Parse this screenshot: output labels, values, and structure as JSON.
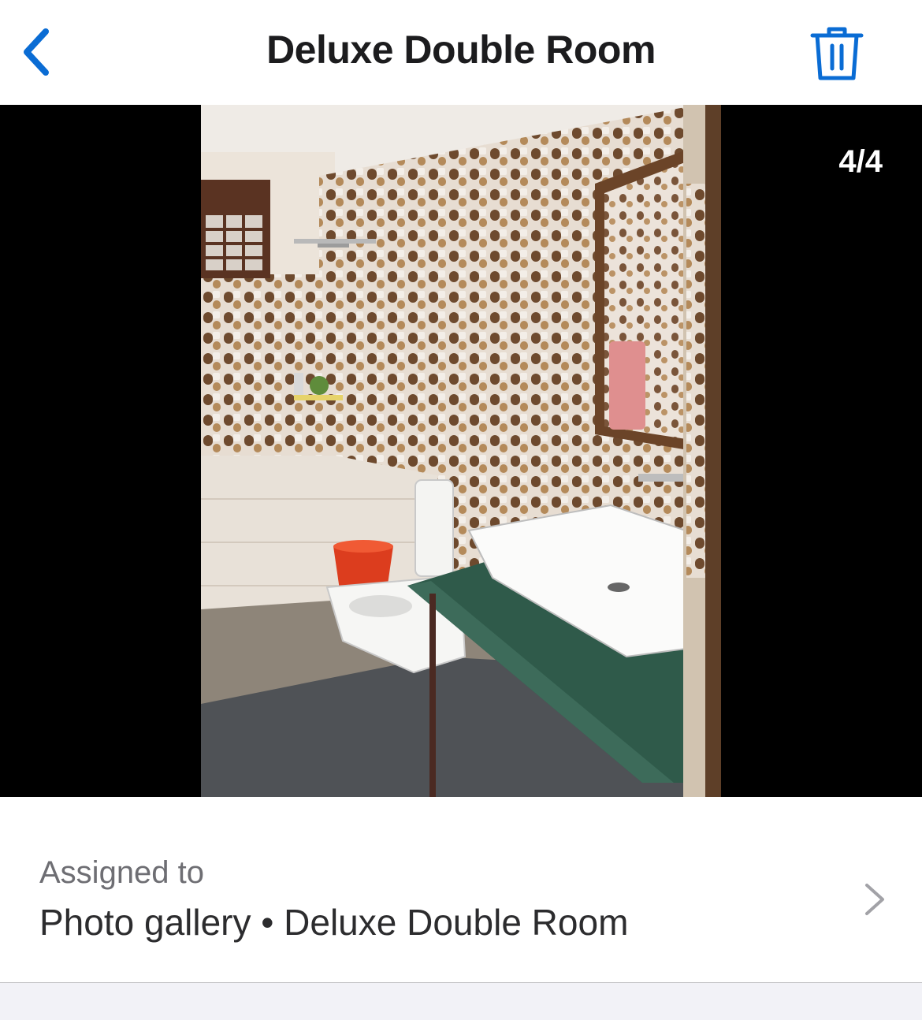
{
  "header": {
    "title": "Deluxe Double Room",
    "back_icon": "chevron-left-icon",
    "delete_icon": "trash-icon",
    "accent_color": "#0a6cd4"
  },
  "viewer": {
    "counter": "4/4",
    "photo_subject": "bathroom"
  },
  "assignment": {
    "label": "Assigned to",
    "value": "Photo gallery • Deluxe Double Room",
    "chevron_icon": "chevron-right-icon"
  }
}
